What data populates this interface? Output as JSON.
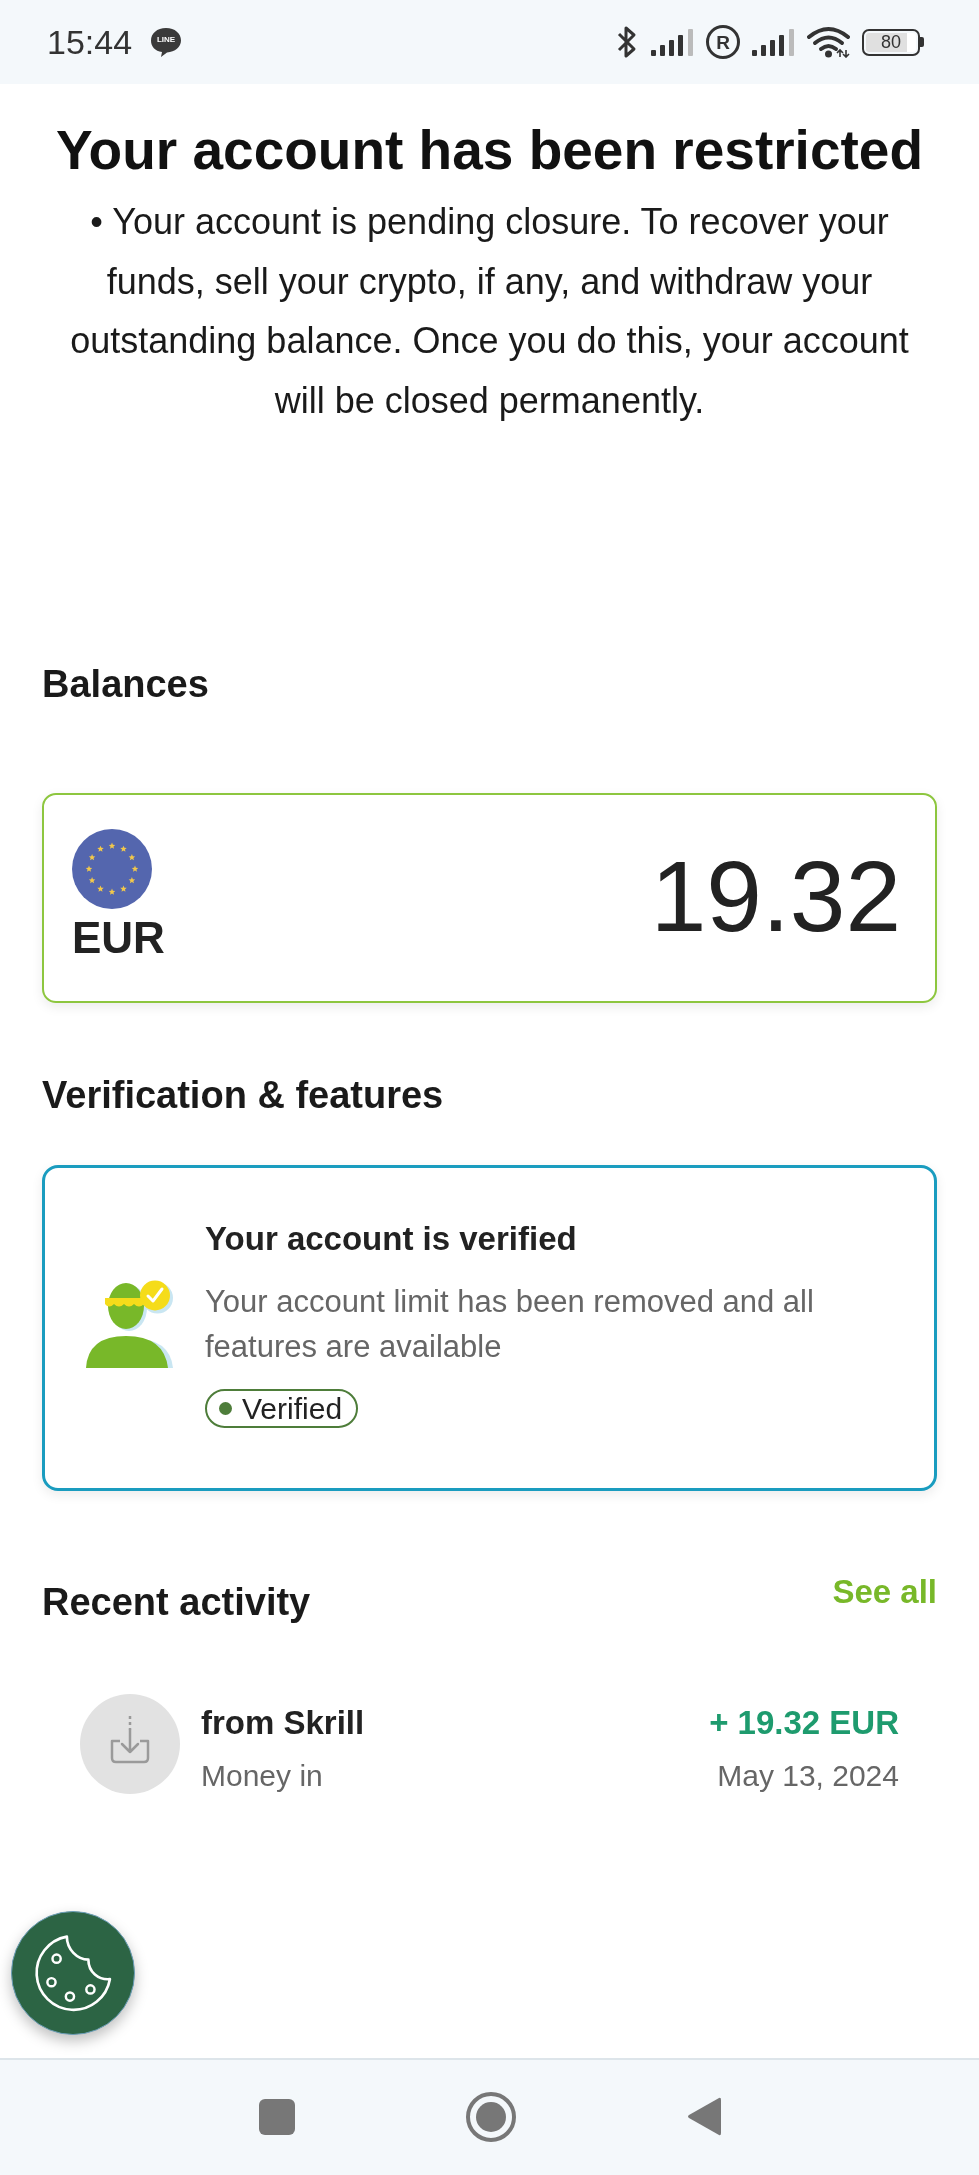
{
  "status_bar": {
    "time": "15:44",
    "app_badge": "LINE",
    "roaming": "R",
    "battery": "80"
  },
  "notice": {
    "title": "Your account has been restricted",
    "message": "• Your account is pending closure. To recover your funds, sell your crypto, if any, and withdraw your outstanding balance. Once you do this, your account will be closed permanently."
  },
  "balances": {
    "heading": "Balances",
    "accounts": [
      {
        "currency": "EUR",
        "amount": "19.32"
      }
    ]
  },
  "verification": {
    "heading": "Verification & features",
    "title": "Your account is verified",
    "description": "Your account limit has been removed and all features are available",
    "status": {
      "label": "Verified"
    }
  },
  "recent_activity": {
    "heading": "Recent activity",
    "see_all": "See all",
    "transactions": [
      {
        "kind": "money_in",
        "title": "from Skrill",
        "type": "Money in",
        "amount": "+ 19.32 EUR",
        "date": "May 13, 2024"
      }
    ]
  }
}
